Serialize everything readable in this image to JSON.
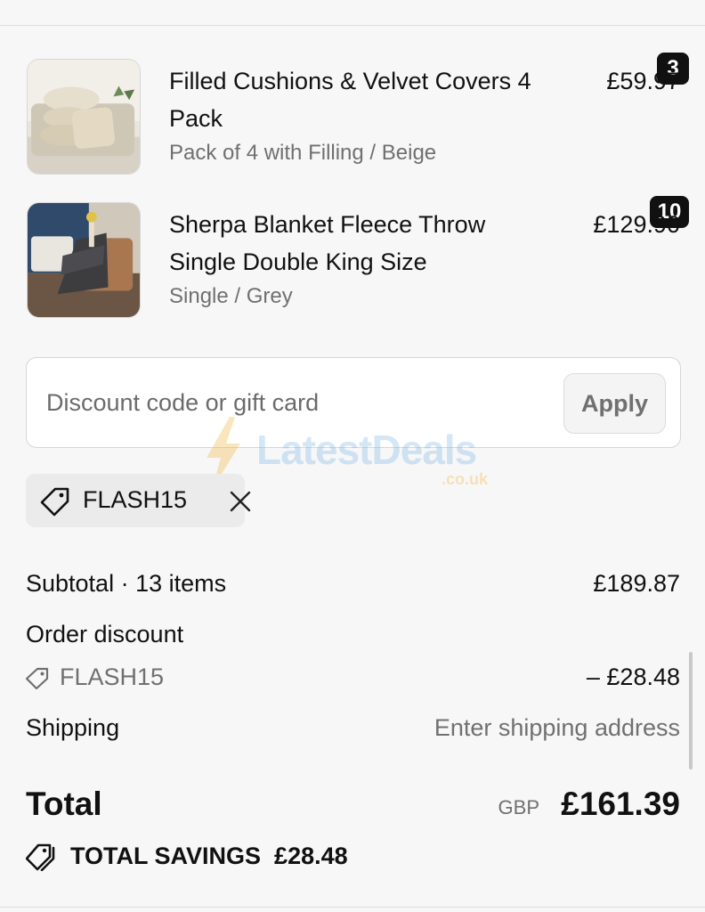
{
  "items": [
    {
      "quantity": "3",
      "title": "Filled Cushions & Velvet Covers 4 Pack",
      "variant": "Pack of 4 with Filling / Beige",
      "price": "£59.97",
      "image": "beige-cushions-image"
    },
    {
      "quantity": "10",
      "title": "Sherpa Blanket Fleece Throw Single Double King Size",
      "variant": "Single / Grey",
      "price": "£129.90",
      "image": "grey-throw-chair-image"
    }
  ],
  "discount": {
    "placeholder": "Discount code or gift card",
    "value": "",
    "apply_label": "Apply",
    "applied_code": "FLASH15"
  },
  "watermark": {
    "name": "LatestDeals",
    "sub": ".co.uk"
  },
  "summary": {
    "subtotal_label": "Subtotal · 13 items",
    "subtotal_value": "£189.87",
    "order_discount_label": "Order discount",
    "discount_code": "FLASH15",
    "discount_value": "– £28.48",
    "shipping_label": "Shipping",
    "shipping_value": "Enter shipping address",
    "total_label": "Total",
    "currency": "GBP",
    "total_value": "£161.39",
    "savings_label": "TOTAL SAVINGS",
    "savings_value": "£28.48"
  },
  "icons": {
    "tag": "tag-icon",
    "close": "close-icon",
    "savings": "tags-icon"
  },
  "colors": {
    "background": "#f7f7f7",
    "text": "#111111",
    "muted": "#707070",
    "chip": "#ebebeb",
    "badge": "#111111"
  }
}
